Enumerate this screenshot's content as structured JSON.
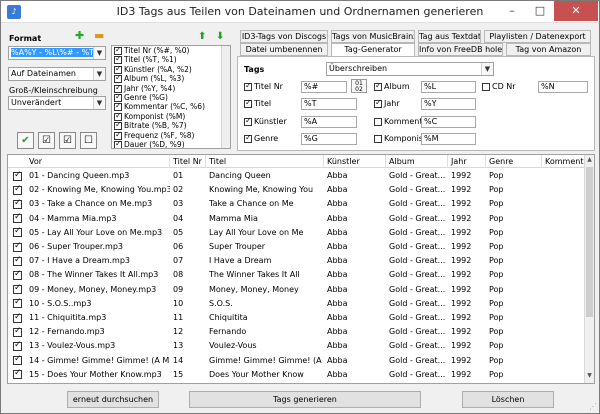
{
  "window": {
    "title": "ID3 Tags aus Teilen von Dateinamen und Ordnernamen generieren",
    "minimize": "–",
    "maximize": "□",
    "close": "✕"
  },
  "left": {
    "format_label": "Format",
    "format_value": "%A%Y - %L\\%# - %T",
    "source_value": "Auf Dateinamen",
    "case_label": "Groß-/Kleinschreibung",
    "case_value": "Unverändert"
  },
  "placeholders": [
    "Titel Nr (%#, %0)",
    "Titel (%T, %1)",
    "Künstler (%A, %2)",
    "Album (%L, %3)",
    "Jahr (%Y, %4)",
    "Genre (%G)",
    "Kommentar (%C, %6)",
    "Komponist (%M)",
    "Bitrate (%B, %7)",
    "Frequenz (%F, %8)",
    "Dauer (%D, %9)"
  ],
  "tabs_row1": [
    "ID3-Tags von Discogs",
    "Tags von MusicBrainz",
    "Tag aus Textdatei",
    "Playlisten / Datenexport"
  ],
  "tabs_row2": [
    "Datei umbenennen",
    "Tag-Generator",
    "Info von FreeDB holen",
    "Tag von Amazon"
  ],
  "panel": {
    "tags_label": "Tags",
    "tags_mode": "Überschreiben",
    "titelnr_label": "Titel Nr",
    "titelnr_value": "%#",
    "numicon_top": "01",
    "numicon_bottom": "02",
    "album_label": "Album",
    "album_value": "%L",
    "cdnr_label": "CD Nr",
    "cdnr_value": "%N",
    "titel_label": "Titel",
    "titel_value": "%T",
    "jahr_label": "Jahr",
    "jahr_value": "%Y",
    "kuenstler_label": "Künstler",
    "kuenstler_value": "%A",
    "kommentar_label": "Kommentar",
    "kommentar_value": "%C",
    "genre_label": "Genre",
    "genre_value": "%G",
    "komponist_label": "Komponist",
    "komponist_value": "%M"
  },
  "table": {
    "headers": [
      "Vor",
      "Titel Nr",
      "Titel",
      "Künstler",
      "Album",
      "Jahr",
      "Genre",
      "Kommentar"
    ],
    "rows": [
      [
        "01 - Dancing Queen.mp3",
        "01",
        "Dancing Queen",
        "Abba",
        "Gold - Great...",
        "1992",
        "Pop"
      ],
      [
        "02 - Knowing Me, Knowing You.mp3",
        "02",
        "Knowing Me, Knowing You",
        "Abba",
        "Gold - Great...",
        "1992",
        "Pop"
      ],
      [
        "03 - Take a Chance on Me.mp3",
        "03",
        "Take a Chance on Me",
        "Abba",
        "Gold - Great...",
        "1992",
        "Pop"
      ],
      [
        "04 - Mamma Mia.mp3",
        "04",
        "Mamma Mia",
        "Abba",
        "Gold - Great...",
        "1992",
        "Pop"
      ],
      [
        "05 - Lay All Your Love on Me.mp3",
        "05",
        "Lay All Your Love on Me",
        "Abba",
        "Gold - Great...",
        "1992",
        "Pop"
      ],
      [
        "06 - Super Trouper.mp3",
        "06",
        "Super Trouper",
        "Abba",
        "Gold - Great...",
        "1992",
        "Pop"
      ],
      [
        "07 - I Have a Dream.mp3",
        "07",
        "I Have a Dream",
        "Abba",
        "Gold - Great...",
        "1992",
        "Pop"
      ],
      [
        "08 - The Winner Takes It All.mp3",
        "08",
        "The Winner Takes It All",
        "Abba",
        "Gold - Great...",
        "1992",
        "Pop"
      ],
      [
        "09 - Money, Money, Money.mp3",
        "09",
        "Money, Money, Money",
        "Abba",
        "Gold - Great...",
        "1992",
        "Pop"
      ],
      [
        "10 - S.O.S..mp3",
        "10",
        "S.O.S.",
        "Abba",
        "Gold - Great...",
        "1992",
        "Pop"
      ],
      [
        "11 - Chiquitita.mp3",
        "11",
        "Chiquitita",
        "Abba",
        "Gold - Great...",
        "1992",
        "Pop"
      ],
      [
        "12 - Fernando.mp3",
        "12",
        "Fernando",
        "Abba",
        "Gold - Great...",
        "1992",
        "Pop"
      ],
      [
        "13 - Voulez-Vous.mp3",
        "13",
        "Voulez-Vous",
        "Abba",
        "Gold - Great...",
        "1992",
        "Pop"
      ],
      [
        "14 - Gimme! Gimme! Gimme! (A M...",
        "14",
        "Gimme! Gimme! Gimme! (A M...",
        "Abba",
        "Gold - Great...",
        "1992",
        "Pop"
      ],
      [
        "15 - Does Your Mother Know.mp3",
        "15",
        "Does Your Mother Know",
        "Abba",
        "Gold - Great...",
        "1992",
        "Pop"
      ]
    ]
  },
  "buttons": {
    "rescan": "erneut durchsuchen",
    "generate": "Tags generieren",
    "delete": "Löschen"
  }
}
